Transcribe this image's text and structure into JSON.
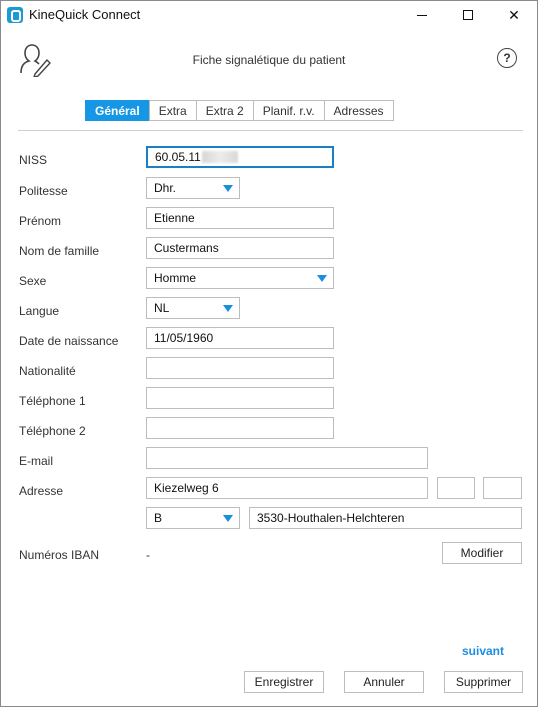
{
  "window": {
    "title": "KineQuick Connect"
  },
  "header": {
    "title": "Fiche signalétique du patient",
    "help": "?"
  },
  "tabs": [
    "Général",
    "Extra",
    "Extra 2",
    "Planif. r.v.",
    "Adresses"
  ],
  "form": {
    "niss": {
      "label": "NISS",
      "value": "60.05.11"
    },
    "politesse": {
      "label": "Politesse",
      "value": "Dhr."
    },
    "prenom": {
      "label": "Prénom",
      "value": "Etienne"
    },
    "nom": {
      "label": "Nom de famille",
      "value": "Custermans"
    },
    "sexe": {
      "label": "Sexe",
      "value": "Homme"
    },
    "langue": {
      "label": "Langue",
      "value": "NL"
    },
    "naissance": {
      "label": "Date de naissance",
      "value": "11/05/1960"
    },
    "nationalite": {
      "label": "Nationalité",
      "value": ""
    },
    "tel1": {
      "label": "Téléphone 1",
      "value": ""
    },
    "tel2": {
      "label": "Téléphone 2",
      "value": ""
    },
    "email": {
      "label": "E-mail",
      "value": ""
    },
    "adresse": {
      "label": "Adresse",
      "street": "Kiezelweg 6",
      "number": "",
      "box": "",
      "country": "B",
      "city": "3530-Houthalen-Helchteren"
    },
    "iban": {
      "label": "Numéros IBAN",
      "value": "-",
      "modify": "Modifier"
    }
  },
  "footer": {
    "next": "suivant",
    "save": "Enregistrer",
    "cancel": "Annuler",
    "delete": "Supprimer"
  },
  "colors": {
    "accent": "#1597e5",
    "link": "#1a8ee0"
  },
  "icons": {
    "app": "app-icon",
    "person": "person-edit-icon",
    "help": "help-icon"
  }
}
